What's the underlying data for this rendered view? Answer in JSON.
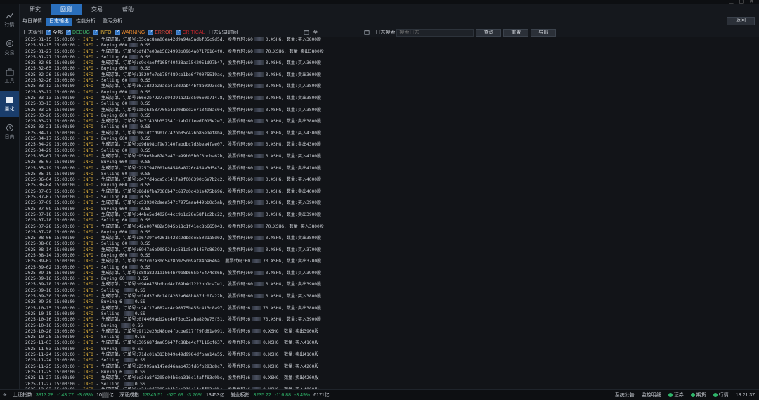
{
  "topnav": {
    "tabs": [
      "研究",
      "回测",
      "交易",
      "帮助"
    ],
    "active": 1
  },
  "leftnav": {
    "items": [
      {
        "label": "行情",
        "icon": "chart-icon"
      },
      {
        "label": "交易",
        "icon": "exchange-icon"
      },
      {
        "label": "工具",
        "icon": "toolbox-icon"
      },
      {
        "label": "量化",
        "icon": "quant-icon"
      },
      {
        "label": "日内",
        "icon": "intraday-icon"
      }
    ],
    "active": 3
  },
  "subtabs": [
    "每日详情",
    "日志输出",
    "性能分析",
    "盈亏分析"
  ],
  "return_label": "返回",
  "filter": {
    "level_label": "日志级别",
    "levels": [
      "全部",
      "DEBUG",
      "INFO",
      "WARNING",
      "ERROR",
      "CRITICAL"
    ],
    "time_label": "日志记录时间",
    "to_label": "至",
    "search_label": "日志搜索:",
    "search_placeholder": "搜索日志",
    "query_btn": "查询",
    "reset_btn": "重置",
    "export_btn": "导出"
  },
  "log_lines": [
    "2025-01-15 15:00:00 - INFO - 生成订单，订单号:35cac8ea00ea42d9a94a5adbf35c9d5d, 股票代码:60▒▒▒0.XSHG, 数量:买入3800股",
    "2025-01-15 15:00:00 - INFO - Buying 600▒▒▒0.SS",
    "2025-01-27 15:00:00 - INFO - 生成订单，订单号:dfd7e03eb5624993b0964a07176164f0, 股票代码:60▒▒▒70.XSHG, 数量:卖出3800股",
    "2025-01-27 15:00:00 - INFO - Selling 60▒▒▒0.SS",
    "2025-02-05 15:00:00 - INFO - 生成订单，订单号:c9c4aeff105f40438aa1542951d97b47, 股票代码:60▒▒▒0.XSHG, 数量:买入3600股",
    "2025-02-05 15:00:00 - INFO - Buying 600▒▒▒0.SS",
    "2025-02-26 15:00:00 - INFO - 生成订单，订单号:1520fe7eb78f489cb1be6f79075519ac, 股票代码:60▒▒▒0.XSHG, 数量:卖出3600股",
    "2025-02-26 15:00:00 - INFO - Selling 60▒▒▒0.SS",
    "2025-03-12 15:00:00 - INFO - 生成订单，订单号:671d22e23ada413d9ab44bf8a0a93cdb, 股票代码:60▒▒▒0.XSHG, 数量:买入3800股",
    "2025-03-12 15:00:00 - INFO - Buying 600▒▒▒0.SS",
    "2025-03-13 15:00:00 - INFO - 生成订单，订单号:66e2b79277d94391a213e50660e71478, 股票代码:60▒▒▒0.XSHG, 数量:卖出3800股",
    "2025-03-13 15:00:00 - INFO - Selling 60▒▒▒0.SS",
    "2025-03-20 15:00:00 - INFO - 生成订单，订单号:abc63537700a4a208bed2e713498ac04, 股票代码:60▒▒▒0.XSHG, 数量:买入3800股",
    "2025-03-20 15:00:00 - INFO - Buying 600▒▒▒0.SS",
    "2025-03-21 15:00:00 - INFO - 生成订单，订单号:1c7f433b35254fc1ab2ffeedf015e2e7, 股票代码:60▒▒▒0.XSHG, 数量:卖出3800股",
    "2025-03-21 15:00:00 - INFO - Selling 60▒▒▒0.SS",
    "2025-04-17 15:00:00 - INFO - 生成订单，订单号:061dffd901c742bb85c426b86e1ef8ba, 股票代码:60▒▒▒0.XSHG, 数量:买入4300股",
    "2025-04-17 15:00:00 - INFO - Buying 600▒▒▒0.SS",
    "2025-04-29 15:00:00 - INFO - 生成订单，订单号:d9d898cf9e7140fabdbc7d3bea4fae07, 股票代码:60▒▒▒0.XSHG, 数量:卖出4300股",
    "2025-04-29 15:00:00 - INFO - Selling 60▒▒▒0.SS",
    "2025-05-07 15:00:00 - INFO - 生成订单，订单号:959e5ba8743a47ca99b05b0f3bcba62b, 股票代码:60▒▒▒0.XSHG, 数量:买入4100股",
    "2025-05-07 15:00:00 - INFO - Buying 600▒▒▒0.SS",
    "2025-05-19 15:00:00 - INFO - 生成订单，订单号:2257947001e64546a8226c454a3d543a, 股票代码:60▒▒▒0.XSHG, 数量:卖出4100股",
    "2025-05-19 15:00:00 - INFO - Selling 60▒▒▒0.SS",
    "2025-06-04 15:00:00 - INFO - 生成订单，订单号:d47fd4bca5c141fa9f006390c6e7b2c2, 股票代码:60▒▒▒0.XSHG, 数量:买入4000股",
    "2025-06-04 15:00:00 - INFO - Buying 600▒▒▒0.SS",
    "2025-07-07 15:00:00 - INFO - 生成订单，订单号:86d6fba7386b47c687d0d431e475b696, 股票代码:60▒▒▒0.XSHG, 数量:卖出4000股",
    "2025-07-07 15:00:00 - INFO - Selling 60▒▒▒0.SS",
    "2025-07-09 15:00:00 - INFO - 生成订单，订单号:c539302daea547c7975aaa449bb0d5ab, 股票代码:60▒▒▒0.XSHG, 数量:买入3900股",
    "2025-07-09 15:00:00 - INFO - Buying 600▒▒▒0.SS",
    "2025-07-18 15:00:00 - INFO - 生成订单，订单号:44be5ed402044cc9b1d28e58f1c2bc22, 股票代码:60▒▒▒0.XSHG, 数量:卖出3900股",
    "2025-07-18 15:00:00 - INFO - Selling 60▒▒▒0.SS",
    "2025-07-28 15:00:00 - INFO - 生成订单，订单号:42e007482a5045b18c1f41ec8b665043, 股票代码:60▒▒▒70.XSHG, 数量:买入3800股",
    "2025-07-28 15:00:00 - INFO - Buying 600▒▒▒0.SS",
    "2025-08-06 15:00:00 - INFO - 生成订单，订单号:a6739f642615428c9dbdde55021a8d02, 股票代码:60▒▒▒0.XSHG, 数量:卖出3800股",
    "2025-08-06 15:00:00 - INFO - Selling 60▒▒▒0.SS",
    "2025-08-14 15:00:00 - INFO - 生成订单，订单号:6947a6e908024ac581a5e91457c86392, 股票代码:60▒▒▒0.XSHG, 数量:买入3700股",
    "2025-08-14 15:00:00 - INFO - Buying 600▒▒▒0.SS",
    "2025-09-02 15:00:00 - INFO - 生成订单，订单号:392c07a30d5428b975d09af84ba646a, 股票代码:60▒▒▒70.XSHG, 数量:卖出3700股",
    "2025-09-02 15:00:00 - INFO - Selling 60▒▒▒0.SS",
    "2025-09-16 15:00:00 - INFO - 生成订单，订单号:c88a8321a1064b79b8b665b75474e86b, 股票代码:60▒▒▒0.XSHG, 数量:买入3900股",
    "2025-09-16 15:00:00 - INFO - Buying 60▒▒▒0.SS",
    "2025-09-18 15:00:00 - INFO - 生成订单，订单号:d94e475bdbcd4c769b4d1222bb1ca7e1, 股票代码:60▒▒▒0.XSHG, 数量:卖出3900股",
    "2025-09-18 15:00:00 - INFO - Selling ▒▒▒0.SS",
    "2025-09-30 15:00:00 - INFO - 生成订单，订单号:d16d37b8c14f4262a648b887dc0fa22b, 股票代码:60▒▒▒0.XSHG, 数量:买入3800股",
    "2025-09-30 15:00:00 - INFO - Buying 6▒▒▒0.SS",
    "2025-10-15 15:00:00 - INFO - 生成订单，订单号:c24f17a882ac4c96875b455c413c8a97, 股票代码:6▒▒▒70.XSHG, 数量:卖出3800股",
    "2025-10-15 15:00:00 - INFO - Selling ▒▒▒0.SS",
    "2025-10-16 15:00:00 - INFO - 生成订单，订单号:0f4469add2ec4e75bc32aba820e75f51, 股票代码:6▒▒▒70.XSHG, 数量:买入3900股",
    "2025-10-16 15:00:00 - INFO - Buying ▒▒▒0.SS",
    "2025-10-28 15:00:00 - INFO - 生成订单，订单号:9f12e20d48de4fbcbe917ff9fd81a091, 股票代码:6▒▒▒0.XSHG, 数量:卖出3900股",
    "2025-10-28 15:00:00 - INFO - Selling ▒▒▒0.SS",
    "2025-11-03 15:00:00 - INFO - 生成订单，订单号:305687daa05647fc88be4cf7116cf637, 股票代码:6▒▒▒0.XSHG, 数量:买入4100股",
    "2025-11-03 15:00:00 - INFO - Buying ▒▒▒0.SS",
    "2025-11-24 15:00:00 - INFO - 生成订单，订单号:71dc01a313b049e49d9984dfbaa14a55, 股票代码:6▒▒▒0.XSHG, 数量:卖出4100股",
    "2025-11-24 15:00:00 - INFO - Selling ▒▒▒0.SS",
    "2025-11-25 15:00:00 - INFO - 生成订单，订单号:25995aa147ed46aab473fd6fb293d8c7, 股票代码:6▒▒▒0.XSHG, 数量:买入4200股",
    "2025-11-25 15:00:00 - INFO - Buying 6▒▒▒0.SS",
    "2025-11-27 15:00:00 - INFO - 生成订单，订单号:e34a8f6205e04b6ea316c14aff83c9bc, 股票代码:6▒▒▒0.XSHG, 数量:卖出4200股",
    "2025-11-27 15:00:00 - INFO - Selling ▒▒▒0.SS",
    "2025-12-03 15:00:00 - INFO - 生成订单，订单号:e34a8f6205e04b6ea316c14aff83c9bc, 股票代码:6▒▒▒0.XSHG, 数量:买入4000股"
  ],
  "statusbar": {
    "indices": [
      {
        "name": "上证指数",
        "value": "3813.28",
        "change": "-143.77",
        "pct": "-3.63%",
        "volume": "10▒▒亿"
      },
      {
        "name": "深证成指",
        "value": "13345.51",
        "change": "-520.69",
        "pct": "-3.76%",
        "volume": "13453亿"
      },
      {
        "name": "创业板指",
        "value": "3235.22",
        "change": "-116.88",
        "pct": "-3.49%",
        "volume": "6171亿"
      }
    ],
    "right": [
      "系统公告",
      "监控明细",
      "证券",
      "期货",
      "行情"
    ],
    "time": "18:21:37"
  },
  "colors": {
    "accent": "#2a6fbd",
    "info": "#e2b23a",
    "down": "#2fb56a",
    "debug": "#3fb86b",
    "warning": "#e8882e",
    "error": "#e04a3f"
  }
}
